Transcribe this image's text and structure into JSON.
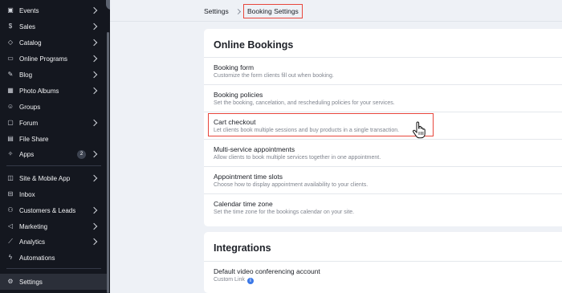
{
  "sidebar": {
    "items": [
      {
        "label": "Events",
        "icon": "calendar-icon",
        "chevron": true
      },
      {
        "label": "Sales",
        "icon": "dollar-icon",
        "chevron": true
      },
      {
        "label": "Catalog",
        "icon": "tag-icon",
        "chevron": true
      },
      {
        "label": "Online Programs",
        "icon": "programs-icon",
        "chevron": true
      },
      {
        "label": "Blog",
        "icon": "pen-icon",
        "chevron": true
      },
      {
        "label": "Photo Albums",
        "icon": "photo-icon",
        "chevron": true
      },
      {
        "label": "Groups",
        "icon": "people-icon",
        "chevron": false
      },
      {
        "label": "Forum",
        "icon": "chat-icon",
        "chevron": true
      },
      {
        "label": "File Share",
        "icon": "file-icon",
        "chevron": false
      },
      {
        "label": "Apps",
        "icon": "apps-icon",
        "chevron": true,
        "badge": "2"
      },
      {
        "label": "Site & Mobile App",
        "icon": "site-icon",
        "chevron": true
      },
      {
        "label": "Inbox",
        "icon": "inbox-icon",
        "chevron": false
      },
      {
        "label": "Customers & Leads",
        "icon": "customers-icon",
        "chevron": true
      },
      {
        "label": "Marketing",
        "icon": "megaphone-icon",
        "chevron": true
      },
      {
        "label": "Analytics",
        "icon": "chart-icon",
        "chevron": true
      },
      {
        "label": "Automations",
        "icon": "lightning-icon",
        "chevron": false
      },
      {
        "label": "Settings",
        "icon": "gear-icon",
        "chevron": false,
        "active": true
      }
    ]
  },
  "breadcrumb": {
    "parent": "Settings",
    "current": "Booking Settings"
  },
  "online_bookings": {
    "title": "Online Bookings",
    "rows": [
      {
        "title": "Booking form",
        "subtitle": "Customize the form clients fill out when booking."
      },
      {
        "title": "Booking policies",
        "subtitle": "Set the booking, cancelation, and rescheduling policies for your services."
      },
      {
        "title": "Cart checkout",
        "subtitle": "Let clients book multiple sessions and buy products in a single transaction."
      },
      {
        "title": "Multi-service appointments",
        "subtitle": "Allow clients to book multiple services together in one appointment."
      },
      {
        "title": "Appointment time slots",
        "subtitle": "Choose how to display appointment availability to your clients."
      },
      {
        "title": "Calendar time zone",
        "subtitle": "Set the time zone for the bookings calendar on your site."
      }
    ]
  },
  "integrations": {
    "title": "Integrations",
    "rows": [
      {
        "title": "Default video conferencing account",
        "subtitle": "Custom Link"
      }
    ]
  },
  "colors": {
    "sidebar_bg": "#14171f",
    "highlight": "#e8463c",
    "info": "#3b78e7"
  }
}
